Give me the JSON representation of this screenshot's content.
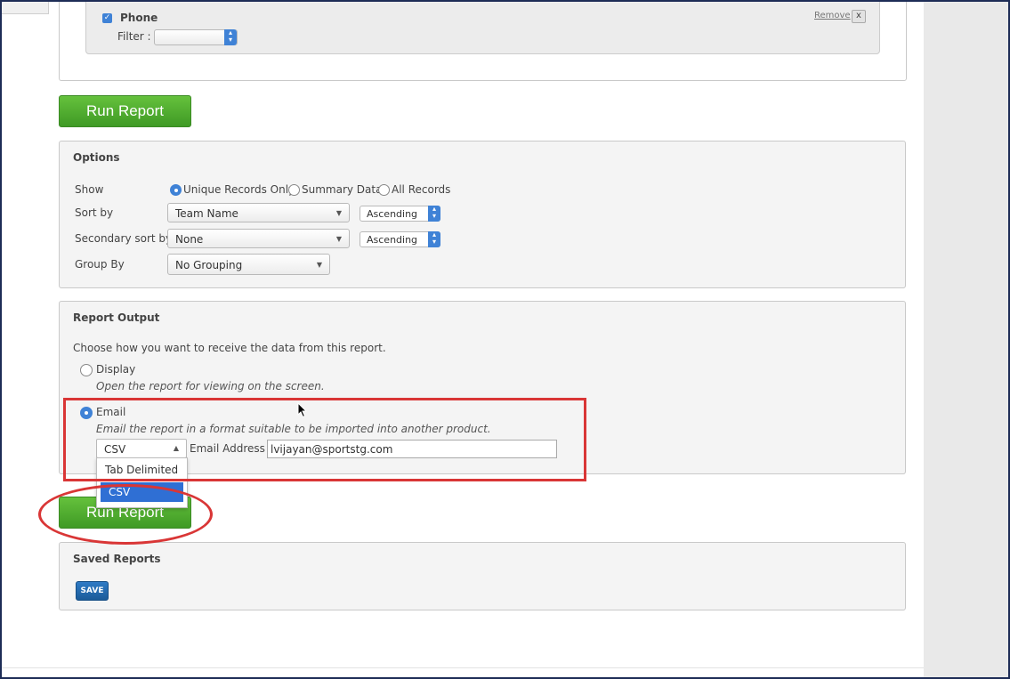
{
  "colors": {
    "accent_blue": "#3f82d6",
    "run_report_green": "#4fa92e",
    "annotation_red": "#d93636",
    "save_blue": "#1f64a8"
  },
  "field": {
    "name": "Phone",
    "checked": true,
    "filter_label": "Filter :",
    "filter_value": "",
    "remove_label": "Remove",
    "remove_x": "x"
  },
  "run_report_label": "Run Report",
  "options": {
    "title": "Options",
    "show_label": "Show",
    "show_choices": [
      "Unique Records Only",
      "Summary Data",
      "All Records"
    ],
    "show_selected": "Unique Records Only",
    "sort_by_label": "Sort by",
    "sort_by_value": "Team Name",
    "sort_by_order": "Ascending",
    "secondary_sort_label": "Secondary sort by",
    "secondary_sort_value": "None",
    "secondary_sort_order": "Ascending",
    "group_by_label": "Group By",
    "group_by_value": "No Grouping"
  },
  "output": {
    "title": "Report Output",
    "intro": "Choose how you want to receive the data from this report.",
    "display_label": "Display",
    "display_desc": "Open the report for viewing on the screen.",
    "email_label": "Email",
    "email_desc": "Email the report in a format suitable to be imported into another product.",
    "selected": "Email",
    "format_value": "CSV",
    "format_options": [
      "Tab Delimited",
      "CSV"
    ],
    "format_highlighted": "CSV",
    "email_address_label": "Email Address",
    "email_address_value": "lvijayan@sportstg.com"
  },
  "saved": {
    "title": "Saved Reports",
    "save_label": "SAVE"
  },
  "icons": {
    "checkbox": "checkmark-icon",
    "cursor": "mouse-pointer-icon"
  }
}
